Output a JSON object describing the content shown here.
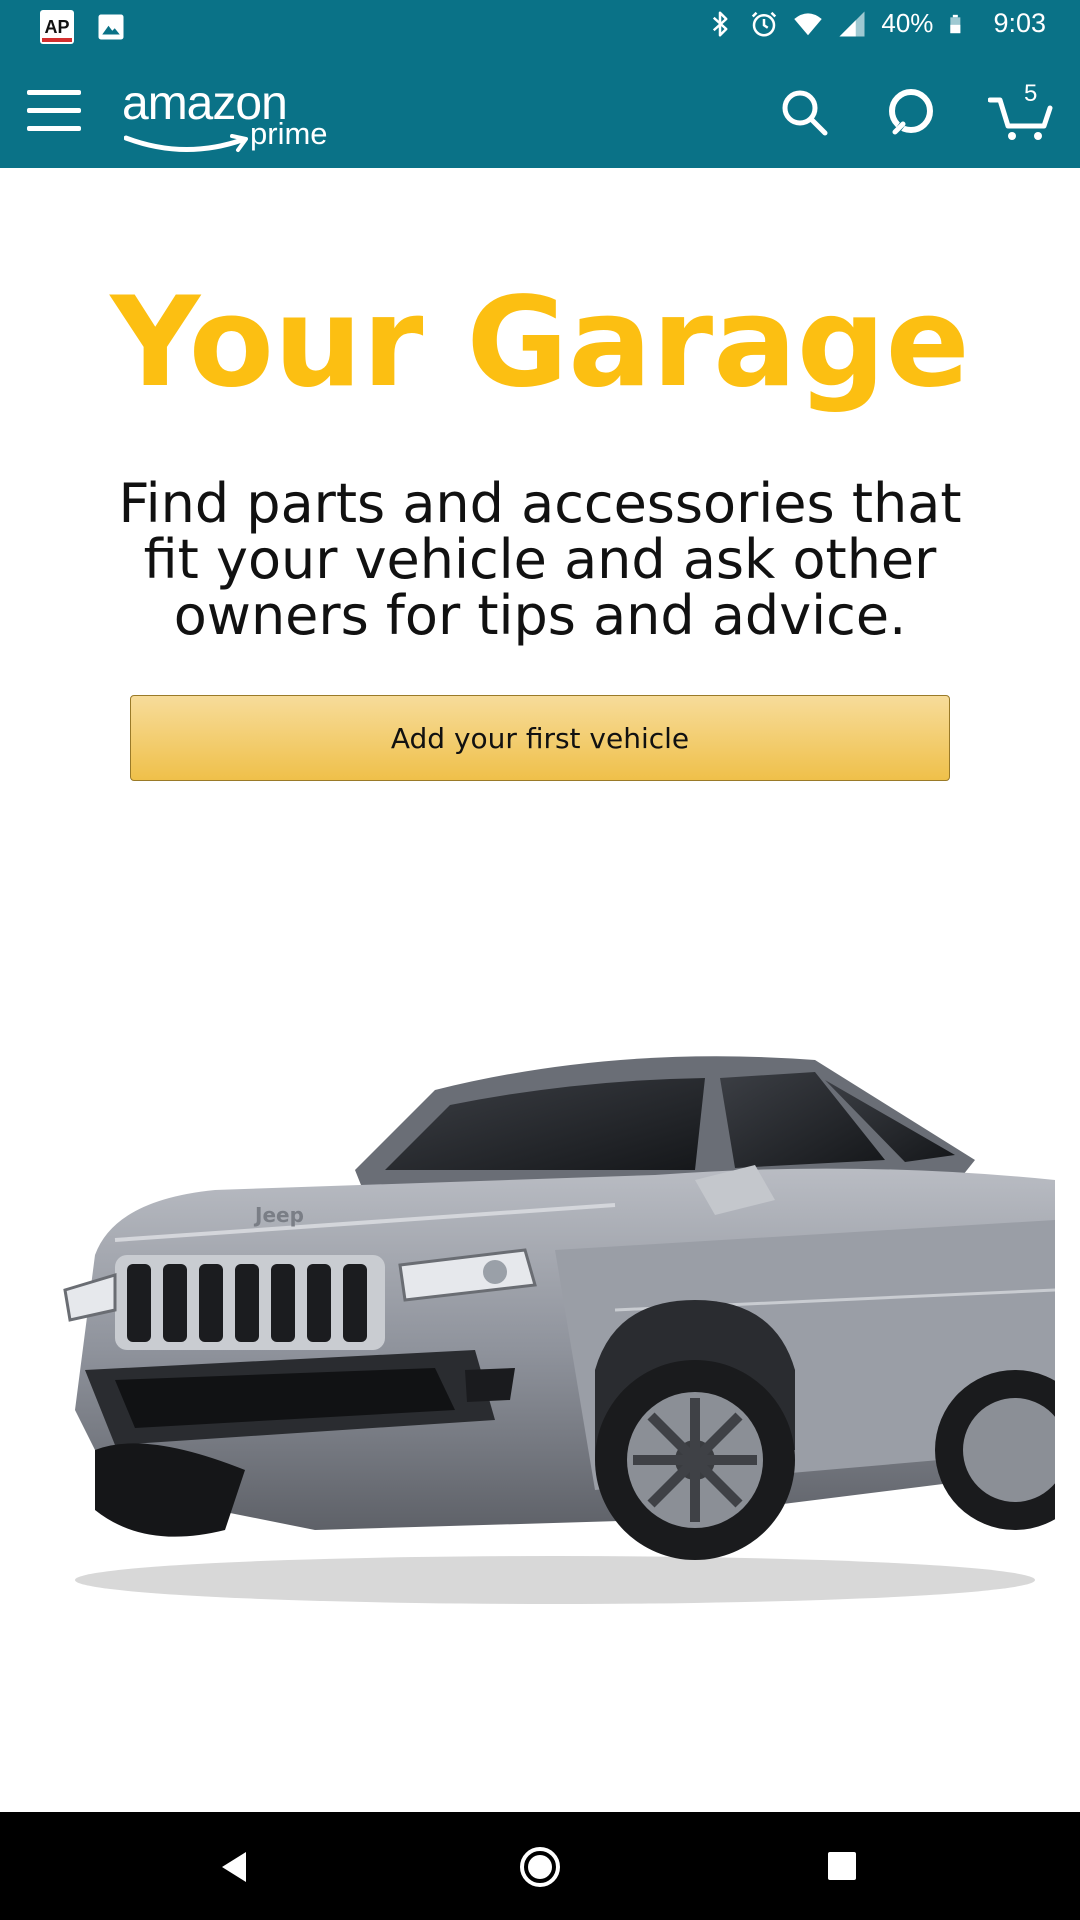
{
  "status_bar": {
    "notifications": [
      "ap-news-icon",
      "gallery-icon"
    ],
    "system_icons": [
      "bluetooth-icon",
      "alarm-icon",
      "wifi-icon",
      "signal-icon"
    ],
    "battery": "40%",
    "time": "9:03"
  },
  "app_bar": {
    "logo_top": "amazon",
    "logo_bottom": "prime",
    "cart_count": "5",
    "brand_color": "#0a7287"
  },
  "main": {
    "title": "Your Garage",
    "title_color": "#fcbf12",
    "description": "Find parts and accessories that fit your vehicle and ask other owners for tips and advice.",
    "primary_button": "Add your first vehicle",
    "vehicle_badge": "Jeep"
  },
  "nav_bar": {
    "buttons": [
      "back",
      "home",
      "recents"
    ]
  }
}
